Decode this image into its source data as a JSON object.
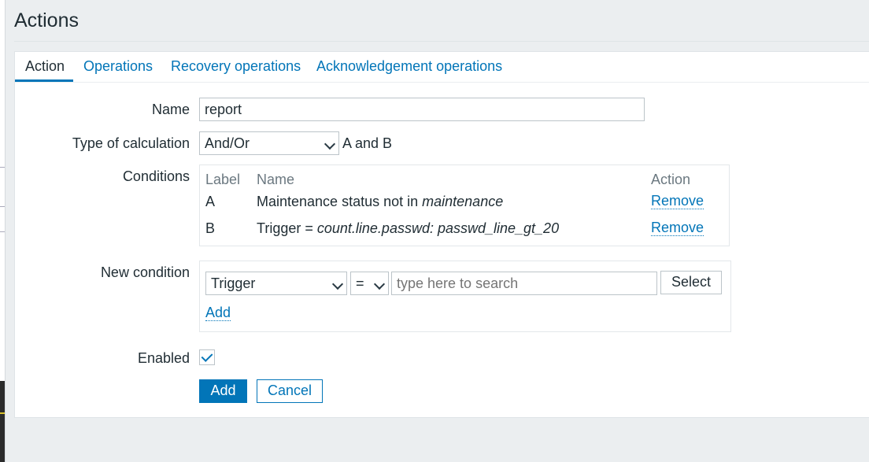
{
  "page": {
    "title": "Actions"
  },
  "tabs": [
    {
      "label": "Action",
      "active": true
    },
    {
      "label": "Operations",
      "active": false
    },
    {
      "label": "Recovery operations",
      "active": false
    },
    {
      "label": "Acknowledgement operations",
      "active": false
    }
  ],
  "form": {
    "name_label": "Name",
    "name_value": "report",
    "calc_label": "Type of calculation",
    "calc_value": "And/Or",
    "calc_formula": "A and B",
    "conditions_label": "Conditions",
    "conditions_table": {
      "headers": {
        "label": "Label",
        "name": "Name",
        "action": "Action"
      },
      "rows": [
        {
          "label": "A",
          "name_prefix": "Maintenance status not in ",
          "name_italic": "maintenance",
          "action": "Remove"
        },
        {
          "label": "B",
          "name_prefix": "Trigger = ",
          "name_italic": "count.line.passwd: passwd_line_gt_20",
          "action": "Remove"
        }
      ]
    },
    "new_condition_label": "New condition",
    "new_condition": {
      "type_value": "Trigger",
      "operator_value": "=",
      "search_placeholder": "type here to search",
      "select_button": "Select",
      "add_link": "Add"
    },
    "enabled_label": "Enabled",
    "enabled_checked": true,
    "add_button": "Add",
    "cancel_button": "Cancel"
  },
  "colors": {
    "accent": "#0275b8",
    "background": "#ebeef0",
    "text": "#1f2c33"
  }
}
